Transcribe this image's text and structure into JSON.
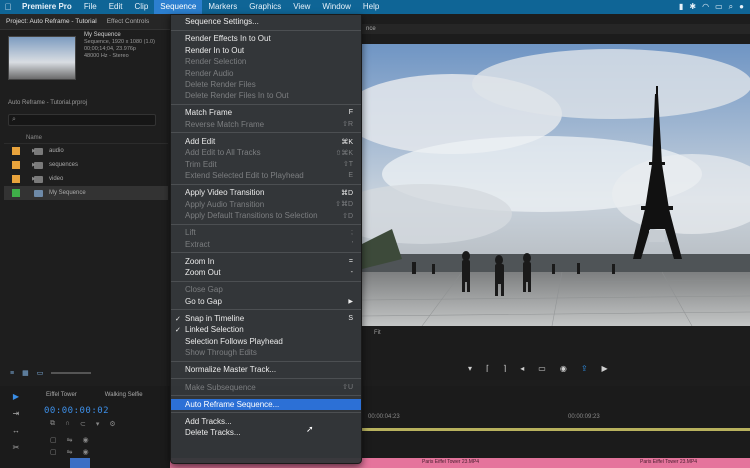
{
  "menubar": {
    "apple_icon": "apple-icon",
    "items": [
      "Premiere Pro",
      "File",
      "Edit",
      "Clip",
      "Sequence",
      "Markers",
      "Graphics",
      "View",
      "Window",
      "Help"
    ],
    "open_index": 4
  },
  "project_panel": {
    "tabs": [
      "Project: Auto Reframe - Tutorial",
      "Effect Controls"
    ],
    "sequence_name": "My Sequence",
    "sequence_meta_1": "Sequence, 1920 x 1080 (1.0)",
    "sequence_meta_2": "00;00;14;04, 23.976p",
    "sequence_meta_3": "48000 Hz - Stereo",
    "file_label": "Auto Reframe - Tutorial.prproj",
    "column_header": "Name",
    "items": [
      {
        "label": "audio",
        "color": "#e8a33c",
        "type": "folder"
      },
      {
        "label": "sequences",
        "color": "#e8a33c",
        "type": "folder"
      },
      {
        "label": "video",
        "color": "#e8a33c",
        "type": "folder"
      },
      {
        "label": "My Sequence",
        "color": "#3fae49",
        "type": "sequence"
      }
    ]
  },
  "monitor": {
    "tab_title": "nce",
    "fit_label": "Fit"
  },
  "timeline": {
    "tabs": [
      "Eiffel Tower",
      "Walking Selfie"
    ],
    "timecode": "00:00:00:02",
    "ruler": [
      "00:00:04:23",
      "00:00:09:23"
    ],
    "clip_labels": [
      "Paris Eiffel Tower 23.MP4",
      "Paris Eiffel Tower 23.MP4"
    ]
  },
  "sequence_menu": [
    {
      "label": "Sequence Settings...",
      "enabled": true
    },
    {
      "sep": true
    },
    {
      "label": "Render Effects In to Out",
      "enabled": true
    },
    {
      "label": "Render In to Out",
      "enabled": true
    },
    {
      "label": "Render Selection",
      "enabled": false
    },
    {
      "label": "Render Audio",
      "enabled": false
    },
    {
      "label": "Delete Render Files",
      "enabled": false
    },
    {
      "label": "Delete Render Files In to Out",
      "enabled": false
    },
    {
      "sep": true
    },
    {
      "label": "Match Frame",
      "enabled": true,
      "shortcut": "F"
    },
    {
      "label": "Reverse Match Frame",
      "enabled": false,
      "shortcut": "⇧R"
    },
    {
      "sep": true
    },
    {
      "label": "Add Edit",
      "enabled": true,
      "shortcut": "⌘K"
    },
    {
      "label": "Add Edit to All Tracks",
      "enabled": false,
      "shortcut": "⇧⌘K"
    },
    {
      "label": "Trim Edit",
      "enabled": false,
      "shortcut": "⇧T"
    },
    {
      "label": "Extend Selected Edit to Playhead",
      "enabled": false,
      "shortcut": "E"
    },
    {
      "sep": true
    },
    {
      "label": "Apply Video Transition",
      "enabled": true,
      "shortcut": "⌘D"
    },
    {
      "label": "Apply Audio Transition",
      "enabled": false,
      "shortcut": "⇧⌘D"
    },
    {
      "label": "Apply Default Transitions to Selection",
      "enabled": false,
      "shortcut": "⇧D"
    },
    {
      "sep": true
    },
    {
      "label": "Lift",
      "enabled": false,
      "shortcut": ";"
    },
    {
      "label": "Extract",
      "enabled": false,
      "shortcut": "'"
    },
    {
      "sep": true
    },
    {
      "label": "Zoom In",
      "enabled": true,
      "shortcut": "="
    },
    {
      "label": "Zoom Out",
      "enabled": true,
      "shortcut": "-"
    },
    {
      "sep": true
    },
    {
      "label": "Close Gap",
      "enabled": false
    },
    {
      "label": "Go to Gap",
      "enabled": true,
      "submenu": true
    },
    {
      "sep": true
    },
    {
      "label": "Snap in Timeline",
      "enabled": true,
      "checked": true,
      "shortcut": "S"
    },
    {
      "label": "Linked Selection",
      "enabled": true,
      "checked": true
    },
    {
      "label": "Selection Follows Playhead",
      "enabled": true
    },
    {
      "label": "Show Through Edits",
      "enabled": false
    },
    {
      "sep": true
    },
    {
      "label": "Normalize Master Track...",
      "enabled": true
    },
    {
      "sep": true
    },
    {
      "label": "Make Subsequence",
      "enabled": false,
      "shortcut": "⇧U"
    },
    {
      "sep": true
    },
    {
      "label": "Auto Reframe Sequence...",
      "enabled": true,
      "highlighted": true
    },
    {
      "sep": true
    },
    {
      "label": "Add Tracks...",
      "enabled": true
    },
    {
      "label": "Delete Tracks...",
      "enabled": true
    }
  ]
}
